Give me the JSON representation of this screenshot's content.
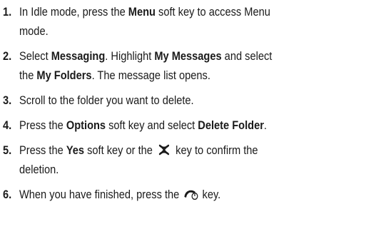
{
  "steps": [
    {
      "number": "1.",
      "lines": [
        {
          "t1": "In Idle mode, press the ",
          "b1": "Menu",
          "t2": " soft key to access Menu"
        },
        {
          "t1": "mode."
        }
      ]
    },
    {
      "number": "2.",
      "lines": [
        {
          "t1": "Select ",
          "b1": "Messaging",
          "t2": ". Highlight ",
          "b2": "My Messages",
          "t3": " and select"
        },
        {
          "t1": "the ",
          "b1": "My Folders",
          "t2": ". The message list opens."
        }
      ]
    },
    {
      "number": "3.",
      "lines": [
        {
          "t1": "Scroll to the folder you want to delete."
        }
      ]
    },
    {
      "number": "4.",
      "lines": [
        {
          "t1": "Press the ",
          "b1": "Options",
          "t2": " soft key and select ",
          "b2": "Delete Folder",
          "t3": "."
        }
      ]
    },
    {
      "number": "5.",
      "lines": [
        {
          "t1": "Press the ",
          "b1": "Yes",
          "t2": " soft key or the ",
          "icon": "ok-key-icon",
          "t3": " key to confirm the"
        },
        {
          "t1": "deletion."
        }
      ]
    },
    {
      "number": "6.",
      "lines": [
        {
          "t1": "When you have finished, press the ",
          "icon": "end-key-icon",
          "t3": " key."
        }
      ]
    }
  ]
}
